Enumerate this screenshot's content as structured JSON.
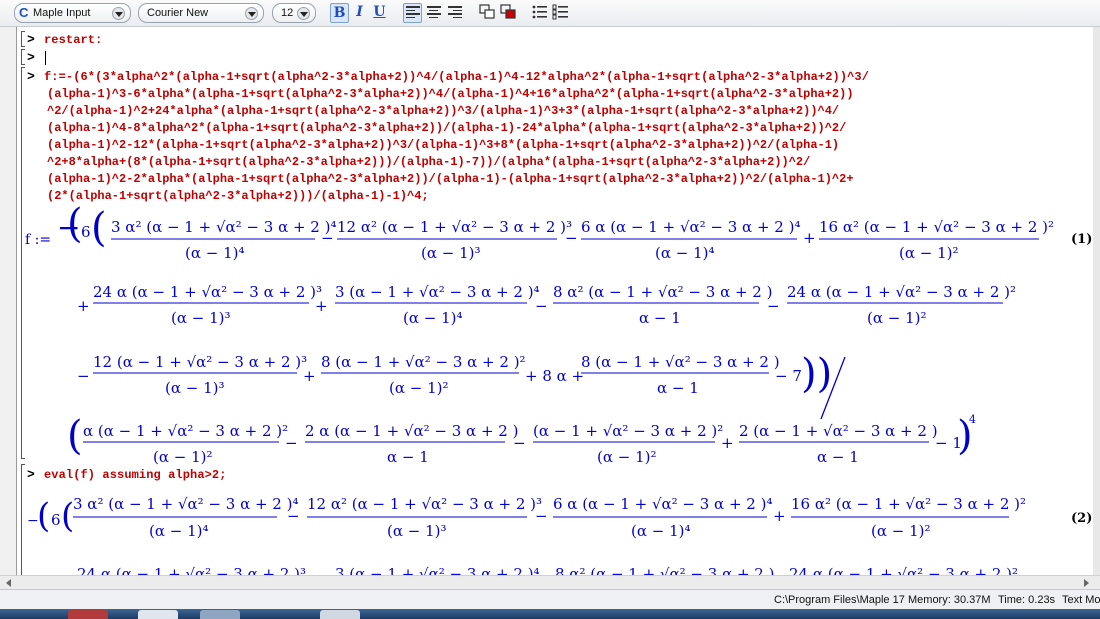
{
  "toolbar": {
    "mode": "Maple Input",
    "mode_icon": "C",
    "font": "Courier New",
    "size": "12",
    "bold": "B",
    "italic": "I",
    "underline": "U"
  },
  "worksheet": {
    "prompt": ">",
    "input1": "restart:",
    "input3_lines": [
      "f:=-(6*(3*alpha^2*(alpha-1+sqrt(alpha^2-3*alpha+2))^4/(alpha-1)^4-12*alpha^2*(alpha-1+sqrt(alpha^2-3*alpha+2))^3/",
      "(alpha-1)^3-6*alpha*(alpha-1+sqrt(alpha^2-3*alpha+2))^4/(alpha-1)^4+16*alpha^2*(alpha-1+sqrt(alpha^2-3*alpha+2))",
      "^2/(alpha-1)^2+24*alpha*(alpha-1+sqrt(alpha^2-3*alpha+2))^3/(alpha-1)^3+3*(alpha-1+sqrt(alpha^2-3*alpha+2))^4/",
      "(alpha-1)^4-8*alpha^2*(alpha-1+sqrt(alpha^2-3*alpha+2))/(alpha-1)-24*alpha*(alpha-1+sqrt(alpha^2-3*alpha+2))^2/",
      "(alpha-1)^2-12*(alpha-1+sqrt(alpha^2-3*alpha+2))^3/(alpha-1)^3+8*(alpha-1+sqrt(alpha^2-3*alpha+2))^2/(alpha-1)",
      "^2+8*alpha+(8*(alpha-1+sqrt(alpha^2-3*alpha+2)))/(alpha-1)-7))/(alpha*(alpha-1+sqrt(alpha^2-3*alpha+2))^2/",
      "(alpha-1)^2-2*alpha*(alpha-1+sqrt(alpha^2-3*alpha+2))/(alpha-1)-(alpha-1+sqrt(alpha^2-3*alpha+2))^2/(alpha-1)^2+",
      "(2*(alpha-1+sqrt(alpha^2-3*alpha+2)))/(alpha-1)-1)^4;"
    ],
    "f_lhs": "f :=",
    "label1": "(1)",
    "input4": "eval(f) assuming alpha>2;",
    "label2": "(2)"
  },
  "status": {
    "path": "C:\\Program Files\\Maple 17",
    "memory": "Memory: 30.37M",
    "time": "Time: 0.23s",
    "mode": "Text Mo"
  }
}
